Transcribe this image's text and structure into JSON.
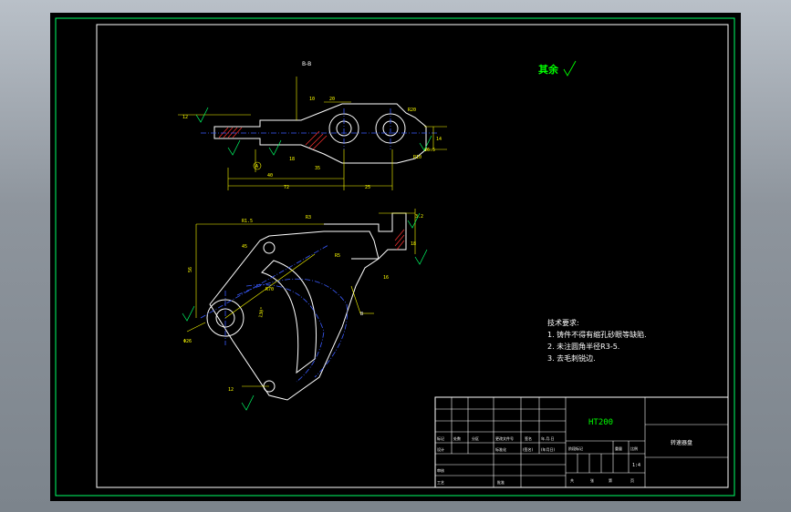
{
  "drawing": {
    "section_label": "B-B",
    "roughness_note": "其余",
    "tech_title": "技术要求:",
    "tech_items": [
      "1.  铸件不得有缩孔砂眼等缺陷.",
      "2.  未注圆角半径R3-5.",
      "3.  去毛刺锐边."
    ],
    "top_dims": {
      "d40": "40",
      "d72": "72",
      "d25": "25",
      "d10": "10",
      "d20": "20",
      "dR20": "R20",
      "dR10": "R10",
      "d18": "18",
      "d35": "35",
      "d14": "14",
      "d16_5": "16.5",
      "dA": "A",
      "d12": "12"
    },
    "front_dims": {
      "dR1_5": "R1.5",
      "dR3": "R3",
      "d56": "56",
      "d45": "45",
      "dR5": "R5",
      "d3_2": "3.2",
      "dR70": "R70",
      "d130": "130°",
      "d16": "16",
      "d18": "18",
      "dB": "B",
      "dphi26": "Φ26",
      "d12": "12"
    }
  },
  "title_block": {
    "material": "HT200",
    "part_name": "转速器盘",
    "scale": "1:4",
    "row_labels": [
      "标记",
      "处数",
      "分区",
      "更改文件号",
      "签名",
      "年.月.日"
    ],
    "design_label": "设计",
    "std_label": "标准化",
    "sign_label": "(签名)",
    "date_label": "(年月日)",
    "review_label": "审核",
    "process_label": "工艺",
    "approve_label": "批准",
    "stage_header": [
      "阶段标记",
      "重量",
      "比例"
    ],
    "sheet_labels": [
      "共",
      "张",
      "第",
      "页"
    ]
  },
  "colors": {
    "frame_green": "#00ff66",
    "outline_white": "#ffffff",
    "dim_yellow": "#ffff00",
    "center_blue": "#3a5bff",
    "hatch_red": "#ff3030",
    "note_green": "#00ff00"
  }
}
